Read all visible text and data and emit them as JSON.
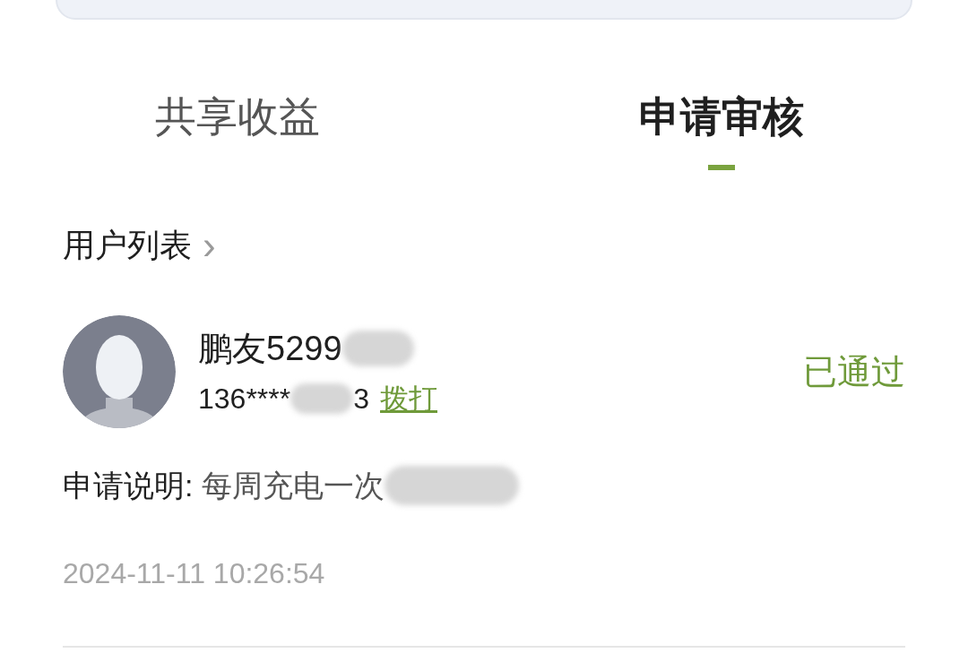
{
  "tabs": [
    {
      "label": "共享收益",
      "selected": false
    },
    {
      "label": "申请审核",
      "selected": true
    }
  ],
  "section_link": {
    "label": "用户列表",
    "icon": "›"
  },
  "applications": [
    {
      "name": "鹏友5299",
      "phone": "136****",
      "phone_tail": "3",
      "call_link": "拨打",
      "status": "已通过",
      "description_label": "申请说明:",
      "description": "每周充电一次",
      "time": "2024-11-11 10:26:54"
    }
  ]
}
